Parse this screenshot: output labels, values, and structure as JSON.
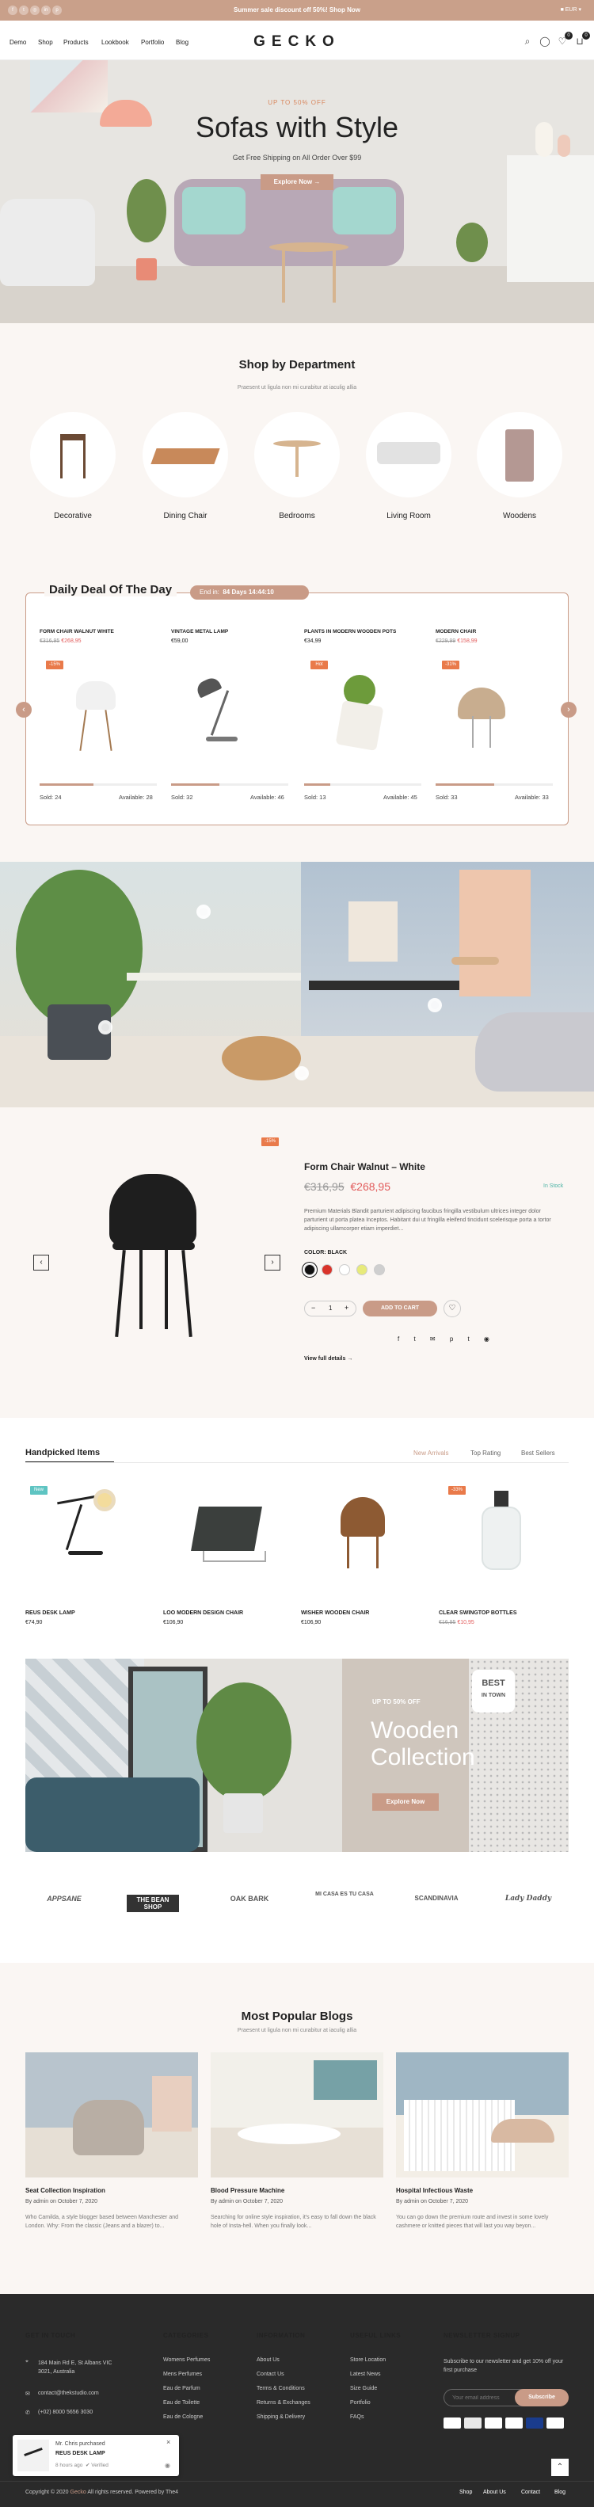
{
  "topbar": {
    "message": "Summer sale discount off 50%! Shop Now",
    "currency": "EUR",
    "social_icons": [
      "facebook-icon",
      "twitter-icon",
      "instagram-icon",
      "linkedin-icon",
      "pinterest-icon"
    ]
  },
  "header": {
    "nav": [
      "Demo",
      "Shop",
      "Products",
      "Lookbook",
      "Portfolio",
      "Blog"
    ],
    "logo": "GECKO",
    "wishlist_count": "0",
    "cart_count": "0"
  },
  "hero": {
    "eyebrow": "UP TO 50% OFF",
    "title": "Sofas with Style",
    "subtitle": "Get Free Shipping on All Order Over $99",
    "cta": "Explore Now →"
  },
  "departments": {
    "title": "Shop by Department",
    "subtitle": "Praesent ut ligula non mi curabitur at iaculig allia",
    "items": [
      "Decorative",
      "Dining Chair",
      "Bedrooms",
      "Living Room",
      "Woodens"
    ]
  },
  "deal": {
    "title": "Daily Deal Of The Day",
    "ends_label": "End in:",
    "countdown": "84 Days 14:44:10",
    "products": [
      {
        "name": "FORM CHAIR WALNUT WHITE",
        "old": "€316,95",
        "new": "€268,95",
        "badge": "-15%",
        "sold": "Sold: 24",
        "available": "Available: 28",
        "progress": 0.46
      },
      {
        "name": "VINTAGE METAL LAMP",
        "old": "",
        "new": "€59,00",
        "badge": "",
        "sold": "Sold: 32",
        "available": "Available: 46",
        "progress": 0.41
      },
      {
        "name": "PLANTS IN MODERN WOODEN POTS",
        "old": "",
        "new": "€34,99",
        "badge": "Hot",
        "sold": "Sold: 13",
        "available": "Available: 45",
        "progress": 0.22
      },
      {
        "name": "MODERN CHAIR",
        "old": "€229,99",
        "new": "€158,99",
        "badge": "-31%",
        "sold": "Sold: 33",
        "available": "Available: 33",
        "progress": 0.5
      }
    ]
  },
  "featured": {
    "badge": "-15%",
    "name": "Form Chair Walnut – White",
    "old_price": "€316,95",
    "new_price": "€268,95",
    "stock": "In Stock",
    "description": "Premium Materials Blandit parturient adipiscing faucibus fringilla vestibulum ultrices integer dolor parturient ut porta platea Inceptos. Habitant dui ut fringilla eleifend tincidunt scelerisque porta a tortor adipiscing ullamcorper etiam imperdiet...",
    "color_label": "COLOR: BLACK",
    "colors": [
      "#111111",
      "#d9342b",
      "#ffffff",
      "#e7ea7a",
      "#cfcfcf"
    ],
    "qty": "1",
    "add_to_cart": "ADD TO CART",
    "view_details": "View full details →"
  },
  "handpicked": {
    "title": "Handpicked Items",
    "tabs": [
      "New Arrivals",
      "Top Rating",
      "Best Sellers"
    ],
    "items": [
      {
        "badge": "New",
        "name": "REUS DESK LAMP",
        "price": "€74,90"
      },
      {
        "badge": "",
        "name": "LOO MODERN DESIGN CHAIR",
        "price": "€106,90"
      },
      {
        "badge": "",
        "name": "WISHER WOODEN CHAIR",
        "price": "€106,90"
      },
      {
        "badge": "-33%",
        "name": "CLEAR SWINGTOP BOTTLES",
        "old": "€16,95",
        "price": "€10,95"
      }
    ]
  },
  "promo": {
    "eyebrow": "UP TO 50% OFF",
    "title_line1": "Wooden",
    "title_line2": "Collection",
    "cta": "Explore Now",
    "sign_line1": "BEST",
    "sign_line2": "IN TOWN"
  },
  "brands": [
    "APPSANE",
    "THE BEAN SHOP",
    "OAK BARK",
    "MI CASA ES TU CASA",
    "SCANDINAVIA",
    "Lady Daddy"
  ],
  "blogs": {
    "title": "Most Popular Blogs",
    "subtitle": "Praesent ut ligula non mi curabitur at iaculig allia",
    "posts": [
      {
        "title": "Seat Collection Inspiration",
        "meta": "By admin on October 7, 2020",
        "excerpt": "Who Camilda, a style blogger based between Manchester and London. Why: From the classic (Jeans and a blazer) to..."
      },
      {
        "title": "Blood Pressure Machine",
        "meta": "By admin on October 7, 2020",
        "excerpt": "Searching for online style inspiration, it's easy to fall down the black hole of Insta-hell. When you finally look..."
      },
      {
        "title": "Hospital Infectious Waste",
        "meta": "By admin on October 7, 2020",
        "excerpt": "You can go down the premium route and invest in some lovely cashmere or knitted pieces that will last you way beyon..."
      }
    ]
  },
  "footer": {
    "touch_title": "GET IN TOUCH",
    "address": "184 Main Rd E, St Albans VIC 3021, Australia",
    "email": "contact@thekstudio.com",
    "phone": "(+02) 8000 5656 3030",
    "categories_title": "CATEGORIES",
    "categories": [
      "Womens Perfumes",
      "Mens Perfumes",
      "Eau de Parfum",
      "Eau de Toilette",
      "Eau de Cologne"
    ],
    "info_title": "INFORMATION",
    "info": [
      "About Us",
      "Contact Us",
      "Terms & Conditions",
      "Returns & Exchanges",
      "Shipping & Delivery"
    ],
    "links_title": "USEFUL LINKS",
    "links": [
      "Store Location",
      "Latest News",
      "Size Guide",
      "Portfolio",
      "FAQs"
    ],
    "news_title": "NEWSLETTER SIGNUP",
    "news_text": "Subscribe to our newsletter and get 10% off your first purchase",
    "news_placeholder": "Your email address",
    "news_button": "Subscribe",
    "copyright_prefix": "Copyright © 2020",
    "copyright_brand": "Gecko",
    "copyright_suffix": "All rights reserved. Powered by The4",
    "bottom_links": [
      "Shop",
      "About Us",
      "Contact",
      "Blog"
    ]
  },
  "popup": {
    "who": "Mr. Chris purchased",
    "item": "REUS DESK LAMP",
    "time": "8 hours ago",
    "verified": "Verified"
  }
}
